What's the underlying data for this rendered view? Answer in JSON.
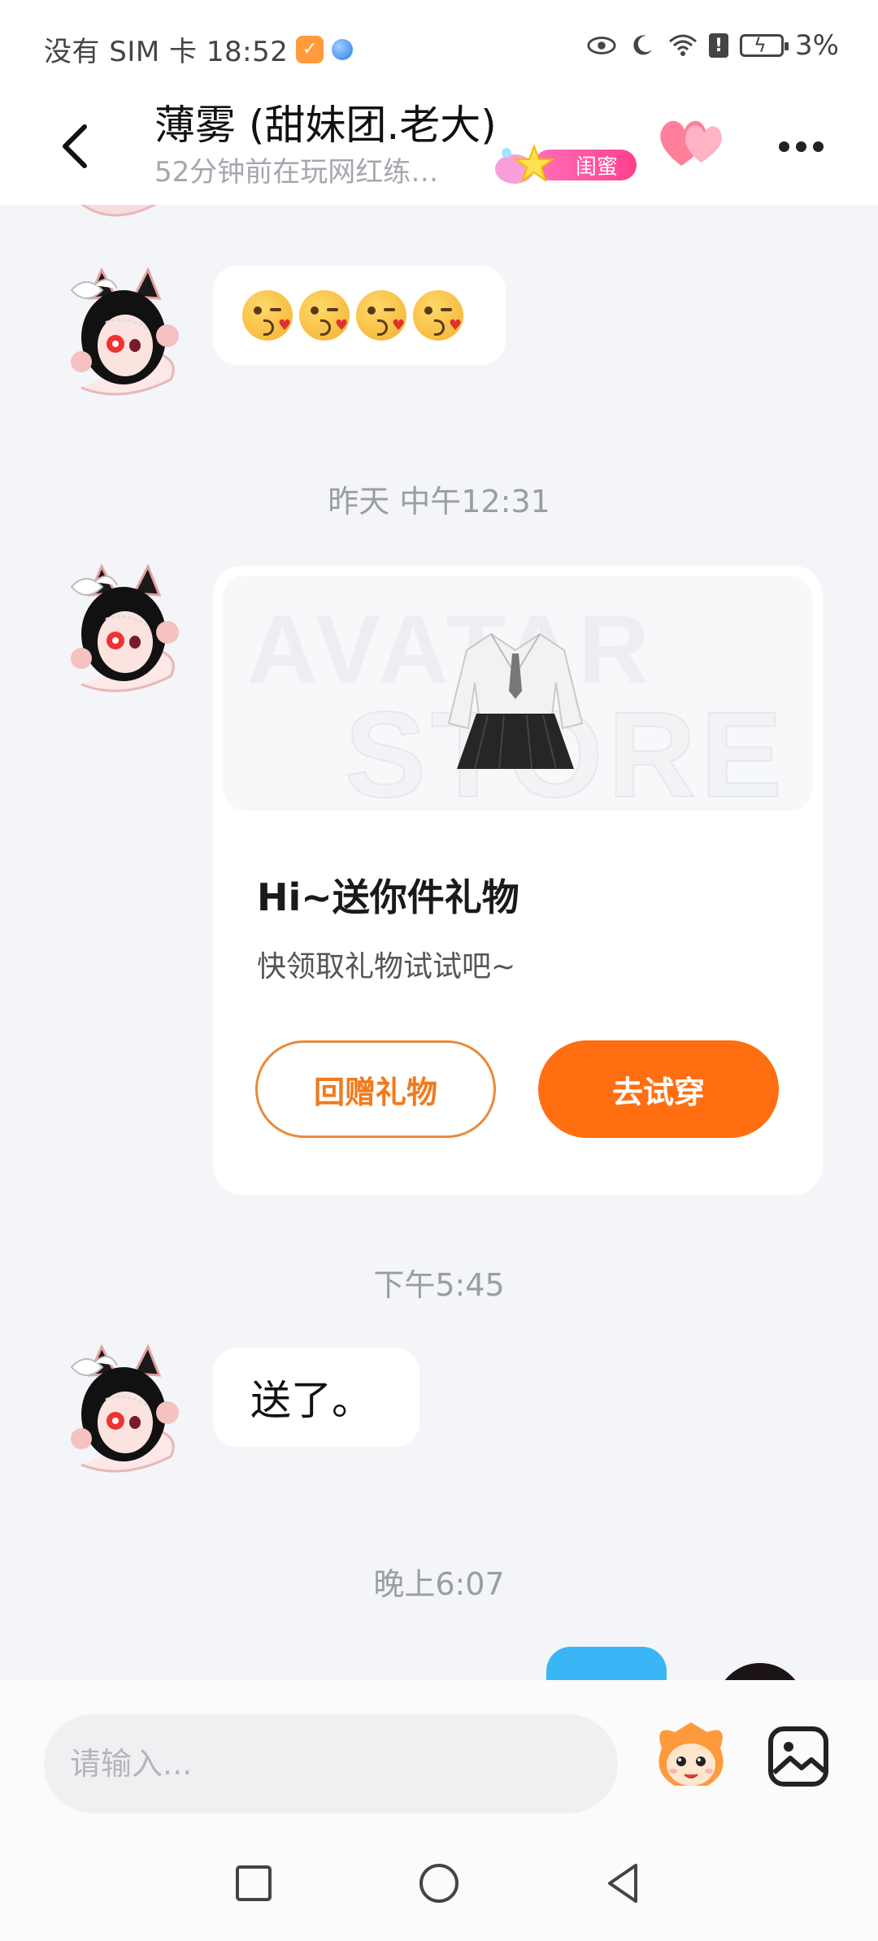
{
  "status_bar": {
    "left_text": "没有 SIM 卡 18:52",
    "battery": "3%",
    "icons": [
      "app-notification-icon",
      "browser-dot-icon",
      "eye-icon",
      "moon-icon",
      "wifi-icon",
      "alert-icon",
      "battery-charging-icon"
    ]
  },
  "header": {
    "title": "薄雾 (甜妹团.老大)",
    "subtitle": "52分钟前在玩网红练…",
    "badge": "闺蜜",
    "icons": [
      "back-chevron-icon",
      "hearts-icon",
      "more-dots-icon"
    ]
  },
  "messages": {
    "time_1": "昨天 中午12:31",
    "time_2": "下午5:45",
    "time_3": "晚上6:07",
    "text_1": "送了。",
    "emoji_count": 4,
    "emoji": "kissing-heart-emoji"
  },
  "gift_card": {
    "watermark_1": "AVATAR",
    "watermark_2": "STORE",
    "title": "Hi~送你件礼物",
    "description": "快领取礼物试试吧~",
    "return_gift_label": "回赠礼物",
    "try_on_label": "去试穿",
    "colors": {
      "accent": "#ff6e10",
      "outline": "#e98a3a"
    }
  },
  "input_bar": {
    "placeholder": "请输入..."
  },
  "colors": {
    "background": "#f4f5f8",
    "bubble_blue": "#3ab5f5",
    "badge_pink": "#ff4f9a"
  }
}
